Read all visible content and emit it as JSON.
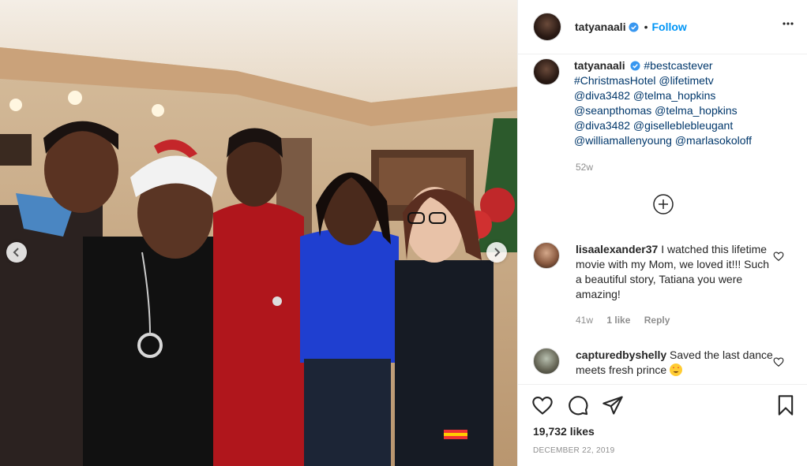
{
  "post": {
    "username": "tatyanaali",
    "follow_label": "Follow",
    "dot": "•",
    "more_label": "•••"
  },
  "caption": {
    "username": "tatyanaali",
    "text": "#bestcastever #ChristmasHotel @lifetimetv @diva3482 @telma_hopkins @seanpthomas @telma_hopkins @diva3482 @giselleblue gant",
    "lines": [
      "#bestcastever",
      "#ChristmasHotel @lifetimetv",
      "@diva3482 @telma_hopkins",
      "@seanpthomas @telma_hopkins",
      "@diva3482 @giselleblebleugant",
      "@williamallenyoung @marlasokoloff"
    ],
    "time": "52w"
  },
  "comments": [
    {
      "username": "lisaalexander37",
      "text": "I watched this lifetime movie with my Mom, we loved it!!! Such a beautiful story, Tatiana you were amazing!",
      "time": "41w",
      "likes": "1 like",
      "reply": "Reply"
    },
    {
      "username": "capturedbyshelly",
      "text": "Saved the last dance meets fresh prince",
      "emoji": "star-struck-emoji"
    }
  ],
  "stats": {
    "likes": "19,732 likes",
    "date": "DECEMBER 22, 2019"
  },
  "colors": {
    "accent": "#0095f6",
    "link": "#00376b",
    "muted": "#8e8e8e",
    "verified": "#3897f0"
  },
  "icons": [
    "verified-badge-icon",
    "more-options-icon",
    "add-circle-icon",
    "heart-icon",
    "comment-icon",
    "share-icon",
    "bookmark-icon",
    "chevron-left-icon",
    "chevron-right-icon"
  ]
}
